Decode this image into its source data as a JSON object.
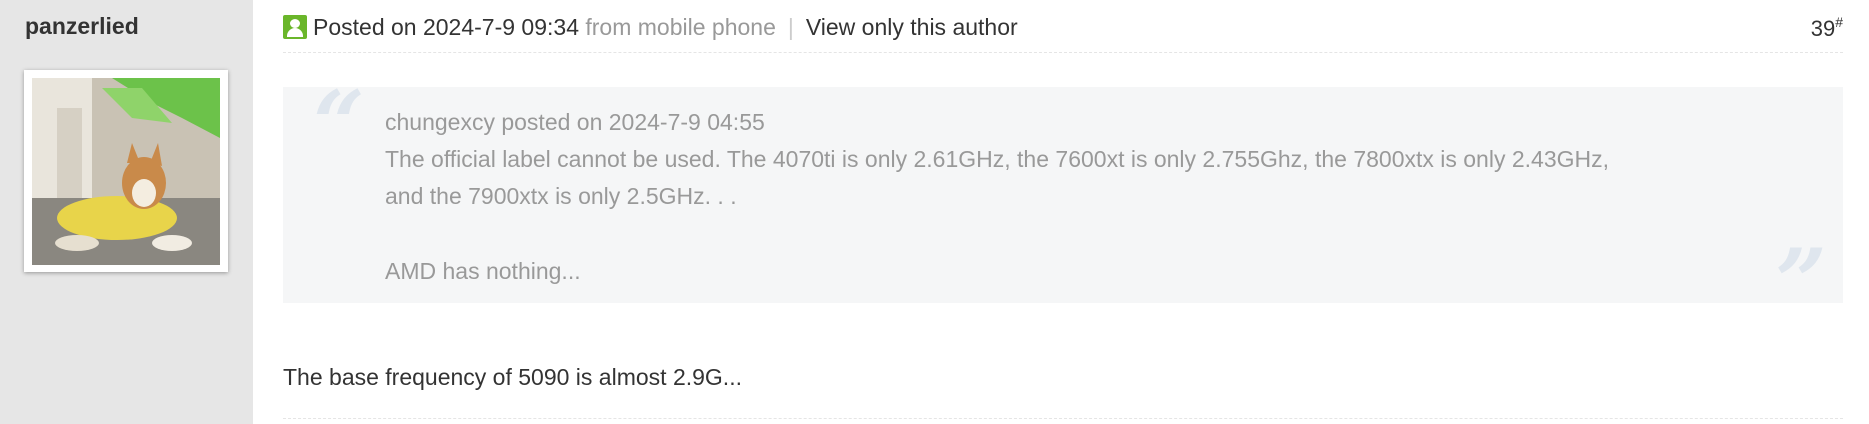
{
  "post": {
    "author": "panzerlied",
    "posted_label": "Posted on 2024-7-9 09:34",
    "source": "from mobile phone",
    "separator": "|",
    "view_only_author": "View only this author",
    "floor_number": "39",
    "floor_mark": "#"
  },
  "quote": {
    "header": "chungexcy posted on 2024-7-9 04:55",
    "line1": "The official label cannot be used. The 4070ti is only 2.61GHz, the 7600xt is only 2.755Ghz, the 7800xtx is only 2.43GHz,",
    "line2": "and the 7900xtx is only 2.5GHz. . .",
    "line3": "AMD has nothing..."
  },
  "reply": {
    "text": "The base frequency of 5090 is almost 2.9G..."
  },
  "icons": {
    "online": "online-user-icon",
    "quote_open": "open-quote-icon",
    "quote_close": "close-quote-icon"
  },
  "colors": {
    "sidebar_bg": "#e6e6e6",
    "online_green": "#6ab62a",
    "quote_bg": "#f5f6f7",
    "muted_text": "#999999"
  }
}
